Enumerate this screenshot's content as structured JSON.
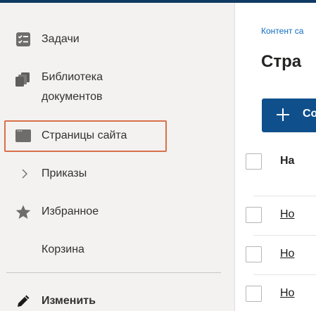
{
  "sidebar": {
    "items": [
      {
        "label": "Задачи",
        "icon": "tasks-icon"
      },
      {
        "label": "Библиотека\nдокументов",
        "icon": "documents-icon"
      },
      {
        "label": "Страницы сайта",
        "icon": "page-icon",
        "selected": true
      },
      {
        "label": "Приказы",
        "icon": "chevron-right-icon"
      },
      {
        "label": "Избранное",
        "icon": "star-icon"
      },
      {
        "label": "Корзина",
        "icon": ""
      }
    ],
    "edit_label": "Изменить",
    "selection_color": "#d9704a"
  },
  "main": {
    "breadcrumb": "Контент са",
    "title": "Стра",
    "new_button_label": "Со",
    "table": {
      "header": "На",
      "rows": [
        {
          "name": "Но"
        },
        {
          "name": "Но"
        },
        {
          "name": "Но"
        }
      ]
    }
  },
  "colors": {
    "accent": "#0f4f8c",
    "topbar": "#0f3a63",
    "sidebar_bg": "#f3f2f1"
  }
}
